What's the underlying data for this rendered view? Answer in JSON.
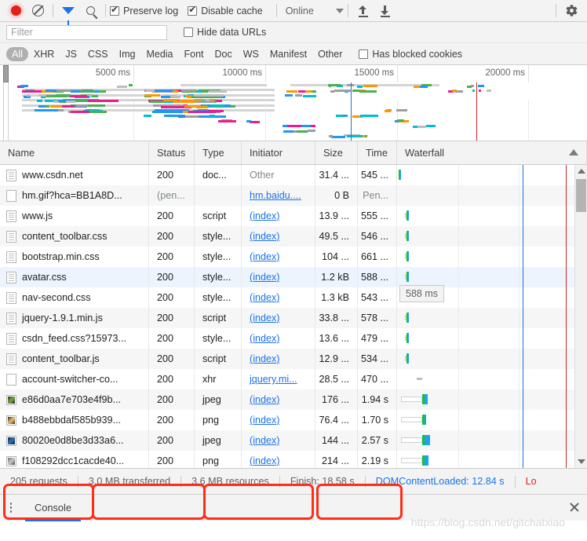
{
  "toolbar": {
    "record_icon": "record-dot-icon",
    "clear_icon": "clear-icon",
    "filter_icon": "funnel-filter-icon",
    "search_icon": "search-icon",
    "preserve_log_label": "Preserve log",
    "preserve_log_checked": true,
    "disable_cache_label": "Disable cache",
    "disable_cache_checked": true,
    "throttle_value": "Online",
    "import_icon": "upload-arrow-icon",
    "export_icon": "download-arrow-icon",
    "settings_icon": "gear-icon"
  },
  "filterbar": {
    "filter_placeholder": "Filter",
    "filter_value": "",
    "hide_data_urls_label": "Hide data URLs",
    "hide_data_urls_checked": false
  },
  "typebar": {
    "types": [
      "All",
      "XHR",
      "JS",
      "CSS",
      "Img",
      "Media",
      "Font",
      "Doc",
      "WS",
      "Manifest",
      "Other"
    ],
    "active_type": "All",
    "has_blocked_cookies_label": "Has blocked cookies",
    "has_blocked_cookies_checked": false
  },
  "overview": {
    "ticks": [
      "5000 ms",
      "10000 ms",
      "15000 ms",
      "20000 ms"
    ],
    "dom_content_loaded_color": "#1a73e8",
    "load_color": "#cc2222"
  },
  "table": {
    "columns": [
      "Name",
      "Status",
      "Type",
      "Initiator",
      "Size",
      "Time",
      "Waterfall"
    ],
    "sort_column": "Waterfall",
    "sort_direction": "asc",
    "rows": [
      {
        "icon": "document-icon",
        "name": "www.csdn.net",
        "status": "200",
        "type": "doc...",
        "initiator": "Other",
        "initiator_link": false,
        "size": "31.4 ...",
        "time": "545 ...",
        "wf_start": 1.5,
        "wf_green": 2.5,
        "wf_blue": 0.6,
        "wf_q": 0
      },
      {
        "icon": "blank-document-icon",
        "name": "hm.gif?hca=BB1A8D...",
        "status": "(pen...",
        "type": "",
        "initiator": "hm.baidu....",
        "initiator_link": true,
        "size": "0 B",
        "time": "Pen...",
        "wf_start": 0,
        "wf_green": 0,
        "wf_blue": 0,
        "wf_q": 0
      },
      {
        "icon": "document-icon",
        "name": "www.js",
        "status": "200",
        "type": "script",
        "initiator": "(index)",
        "initiator_link": true,
        "size": "13.9 ...",
        "time": "555 ...",
        "wf_start": 10,
        "wf_green": 2.2,
        "wf_blue": 0.8,
        "wf_q": 2
      },
      {
        "icon": "document-icon",
        "name": "content_toolbar.css",
        "status": "200",
        "type": "style...",
        "initiator": "(index)",
        "initiator_link": true,
        "size": "49.5 ...",
        "time": "546 ...",
        "wf_start": 10,
        "wf_green": 2.2,
        "wf_blue": 1.2,
        "wf_q": 2
      },
      {
        "icon": "document-icon",
        "name": "bootstrap.min.css",
        "status": "200",
        "type": "style...",
        "initiator": "(index)",
        "initiator_link": true,
        "size": "104 ...",
        "time": "661 ...",
        "wf_start": 10,
        "wf_green": 2.2,
        "wf_blue": 1.2,
        "wf_q": 2
      },
      {
        "icon": "document-icon",
        "name": "avatar.css",
        "status": "200",
        "type": "style...",
        "initiator": "(index)",
        "initiator_link": true,
        "size": "1.2 kB",
        "time": "588 ...",
        "wf_start": 10,
        "wf_green": 2.4,
        "wf_blue": 0.4,
        "wf_q": 2
      },
      {
        "icon": "document-icon",
        "name": "nav-second.css",
        "status": "200",
        "type": "style...",
        "initiator": "(index)",
        "initiator_link": true,
        "size": "1.3 kB",
        "time": "543 ...",
        "wf_start": 10,
        "wf_green": 2.2,
        "wf_blue": 0.5,
        "wf_q": 2
      },
      {
        "icon": "document-icon",
        "name": "jquery-1.9.1.min.js",
        "status": "200",
        "type": "script",
        "initiator": "(index)",
        "initiator_link": true,
        "size": "33.8 ...",
        "time": "578 ...",
        "wf_start": 10,
        "wf_green": 2.2,
        "wf_blue": 0.6,
        "wf_q": 2
      },
      {
        "icon": "document-icon",
        "name": "csdn_feed.css?15973...",
        "status": "200",
        "type": "style...",
        "initiator": "(index)",
        "initiator_link": true,
        "size": "13.6 ...",
        "time": "479 ...",
        "wf_start": 10,
        "wf_green": 2.0,
        "wf_blue": 0.5,
        "wf_q": 2
      },
      {
        "icon": "document-icon",
        "name": "content_toolbar.js",
        "status": "200",
        "type": "script",
        "initiator": "(index)",
        "initiator_link": true,
        "size": "12.9 ...",
        "time": "534 ...",
        "wf_start": 10,
        "wf_green": 2.2,
        "wf_blue": 0.5,
        "wf_q": 2
      },
      {
        "icon": "blank-document-icon",
        "name": "account-switcher-co...",
        "status": "200",
        "type": "xhr",
        "initiator": "jquery.mi...",
        "initiator_link": true,
        "size": "28.5 ...",
        "time": "470 ...",
        "wf_start": 25,
        "wf_green": 0,
        "wf_blue": 0,
        "wf_q": 0,
        "wf_pending": true
      },
      {
        "icon": "image-icon",
        "name": "e86d0aa7e703e4f9b...",
        "status": "200",
        "type": "jpeg",
        "initiator": "(index)",
        "initiator_link": true,
        "size": "176 ...",
        "time": "1.94 s",
        "wf_start": 5,
        "wf_green": 3.2,
        "wf_blue": 4.3,
        "wf_q": 27
      },
      {
        "icon": "image-icon",
        "name": "b488ebbdaf585b939...",
        "status": "200",
        "type": "png",
        "initiator": "(index)",
        "initiator_link": true,
        "size": "76.4 ...",
        "time": "1.70 s",
        "wf_start": 5,
        "wf_green": 3.0,
        "wf_blue": 2.2,
        "wf_q": 27
      },
      {
        "icon": "image-icon",
        "name": "80020e0d8be3d33a6...",
        "status": "200",
        "type": "jpeg",
        "initiator": "(index)",
        "initiator_link": true,
        "size": "144 ...",
        "time": "2.57 s",
        "wf_start": 5,
        "wf_green": 3.4,
        "wf_blue": 6.3,
        "wf_q": 27
      },
      {
        "icon": "image-icon",
        "name": "f108292dcc1cacde40...",
        "status": "200",
        "type": "png",
        "initiator": "(index)",
        "initiator_link": true,
        "size": "214 ...",
        "time": "2.19 s",
        "wf_start": 5,
        "wf_green": 3.2,
        "wf_blue": 5.3,
        "wf_q": 27
      }
    ],
    "tooltip": "588 ms"
  },
  "summary": {
    "requests": "205 requests",
    "transferred": "3.0 MB transferred",
    "resources": "3.6 MB resources",
    "finish": "Finish: 18.58 s",
    "dom_content_loaded": "DOMContentLoaded: 12.84 s",
    "load": "Lo"
  },
  "drawer": {
    "menu_icon": "kebab-menu-icon",
    "console_tab_label": "Console",
    "close_icon": "close-icon"
  },
  "watermark": "https://blog.csdn.net/gitchatxiao"
}
